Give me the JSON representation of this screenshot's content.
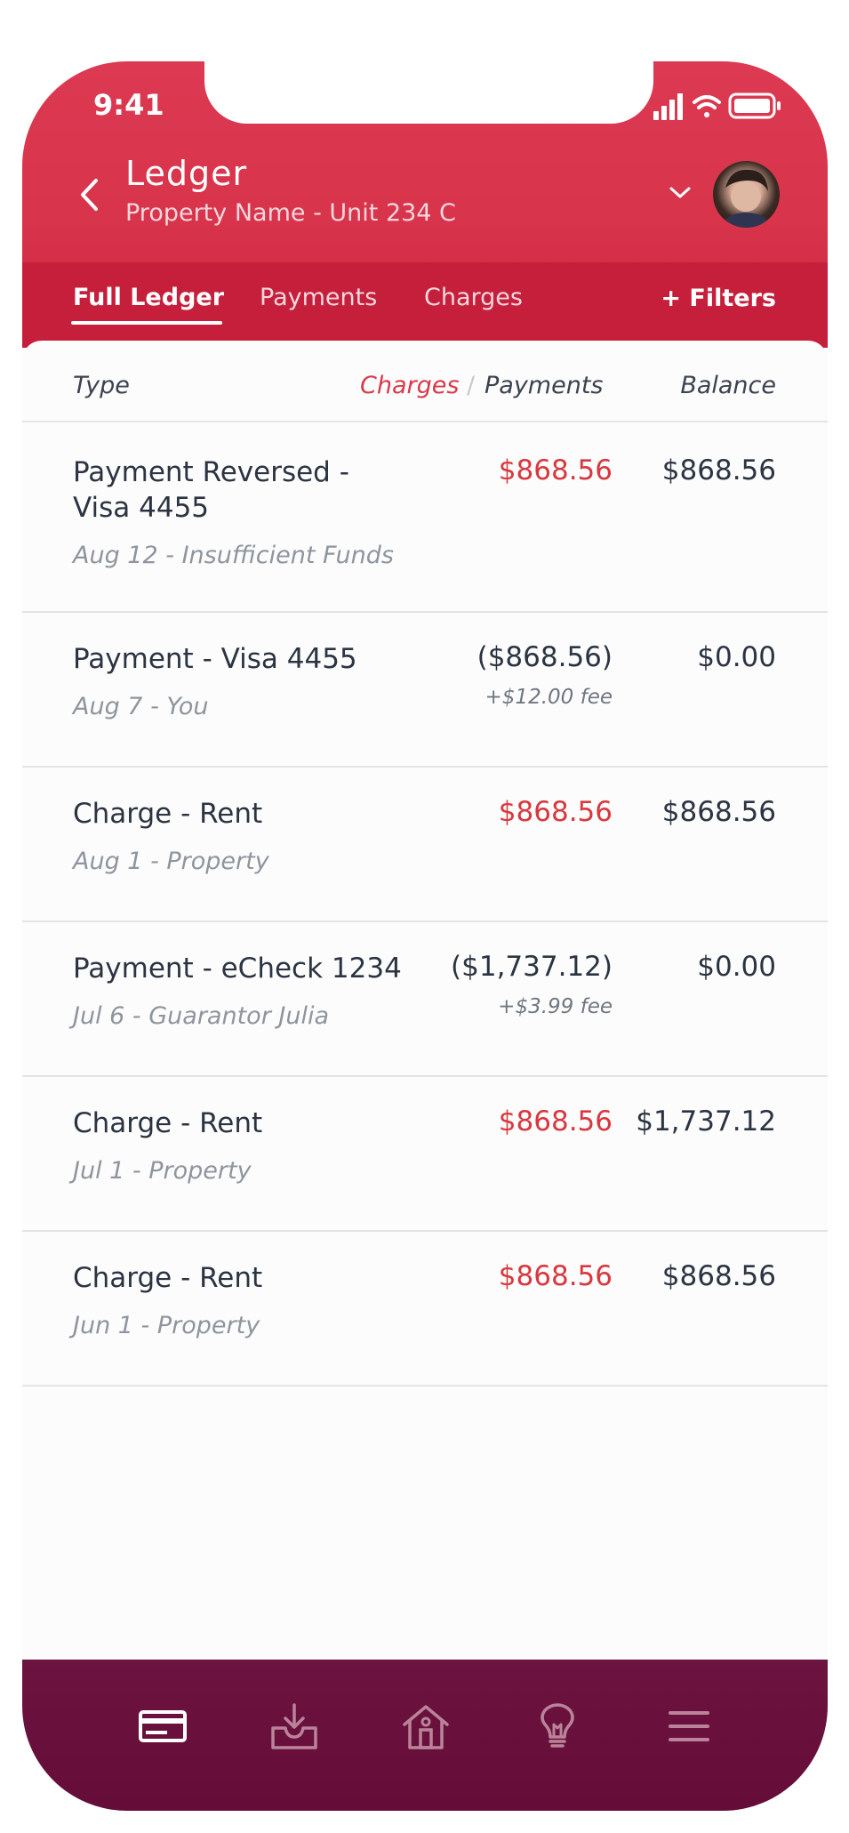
{
  "status": {
    "time": "9:41"
  },
  "header": {
    "title": "Ledger",
    "subtitle": "Property Name - Unit 234 C"
  },
  "tabs": [
    {
      "label": "Full Ledger",
      "active": true
    },
    {
      "label": "Payments",
      "active": false
    },
    {
      "label": "Charges",
      "active": false
    }
  ],
  "filters_label": "+ Filters",
  "columns": {
    "type": "Type",
    "charges": "Charges",
    "slash": "/",
    "payments": "Payments",
    "balance": "Balance"
  },
  "rows": [
    {
      "type": "Payment Reversed - Visa 4455",
      "meta": "Aug 12 - Insufficient Funds",
      "amount": "$868.56",
      "kind": "charge",
      "fee": "",
      "balance": "$868.56"
    },
    {
      "type": "Payment - Visa 4455",
      "meta": "Aug 7 - You",
      "amount": "($868.56)",
      "kind": "payment",
      "fee": "+$12.00 fee",
      "balance": "$0.00"
    },
    {
      "type": "Charge - Rent",
      "meta": "Aug 1 - Property",
      "amount": "$868.56",
      "kind": "charge",
      "fee": "",
      "balance": "$868.56"
    },
    {
      "type": "Payment - eCheck 1234",
      "meta": "Jul 6 - Guarantor Julia",
      "amount": "($1,737.12)",
      "kind": "payment",
      "fee": "+$3.99 fee",
      "balance": "$0.00"
    },
    {
      "type": "Charge - Rent",
      "meta": "Jul 1 - Property",
      "amount": "$868.56",
      "kind": "charge",
      "fee": "",
      "balance": "$1,737.12"
    },
    {
      "type": "Charge - Rent",
      "meta": "Jun 1 - Property",
      "amount": "$868.56",
      "kind": "charge",
      "fee": "",
      "balance": "$868.56"
    }
  ],
  "bottom_nav": [
    {
      "icon": "card-icon",
      "active": true
    },
    {
      "icon": "inbox-download-icon",
      "active": false
    },
    {
      "icon": "home-icon",
      "active": false
    },
    {
      "icon": "lightbulb-icon",
      "active": false
    },
    {
      "icon": "menu-icon",
      "active": false
    }
  ],
  "colors": {
    "header_red": "#dc3a52",
    "tab_red": "#c61f3b",
    "charge_red": "#d8383f",
    "nav_maroon": "#6d1340"
  }
}
